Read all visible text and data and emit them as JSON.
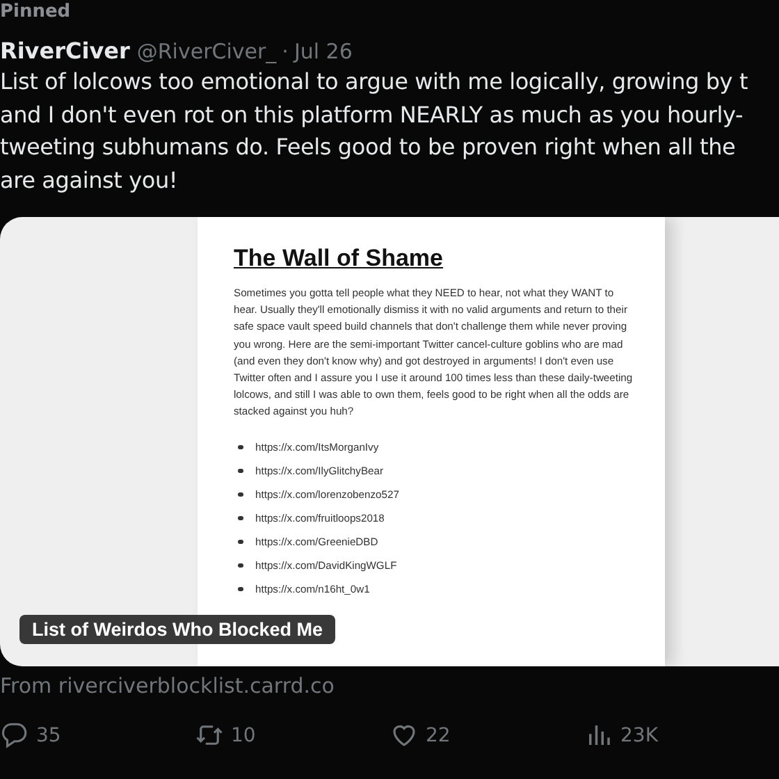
{
  "pinned_label": "Pinned",
  "post": {
    "author": "RiverCiver",
    "handle": "@RiverCiver_",
    "separator": "·",
    "date": "Jul 26",
    "text_lines": [
      "List of lolcows too emotional to argue with me logically, growing by t",
      "and I don't even rot on this platform NEARLY as much as you hourly-",
      "tweeting subhumans do. Feels good to be proven right when all the",
      "are against you!"
    ]
  },
  "card": {
    "document": {
      "title": "The Wall of Shame",
      "paragraph": "Sometimes you gotta tell people what they NEED to hear, not what they WANT to hear. Usually they'll emotionally dismiss it with no valid arguments and return to their safe space vault speed build channels that don't challenge them while never proving you wrong. Here are the semi-important Twitter cancel-culture goblins who are mad (and even they don't know why) and got destroyed in arguments! I don't even use Twitter often and I assure you I use it around 100 times less than these daily-tweeting lolcows, and still I was able to own them, feels good to be right when all the odds are stacked against you huh?",
      "links": [
        "https://x.com/ItsMorganIvy",
        "https://x.com/IlyGlitchyBear",
        "https://x.com/lorenzobenzo527",
        "https://x.com/fruitloops2018",
        "https://x.com/GreenieDBD",
        "https://x.com/DavidKingWGLF",
        "https://x.com/n16ht_0w1"
      ]
    },
    "caption": "List of Weirdos Who Blocked Me"
  },
  "source": "From riverciverblocklist.carrd.co",
  "actions": [
    {
      "kind": "reply",
      "count": "35"
    },
    {
      "kind": "repost",
      "count": "10"
    },
    {
      "kind": "like",
      "count": "22"
    },
    {
      "kind": "views",
      "count": "23K"
    }
  ]
}
